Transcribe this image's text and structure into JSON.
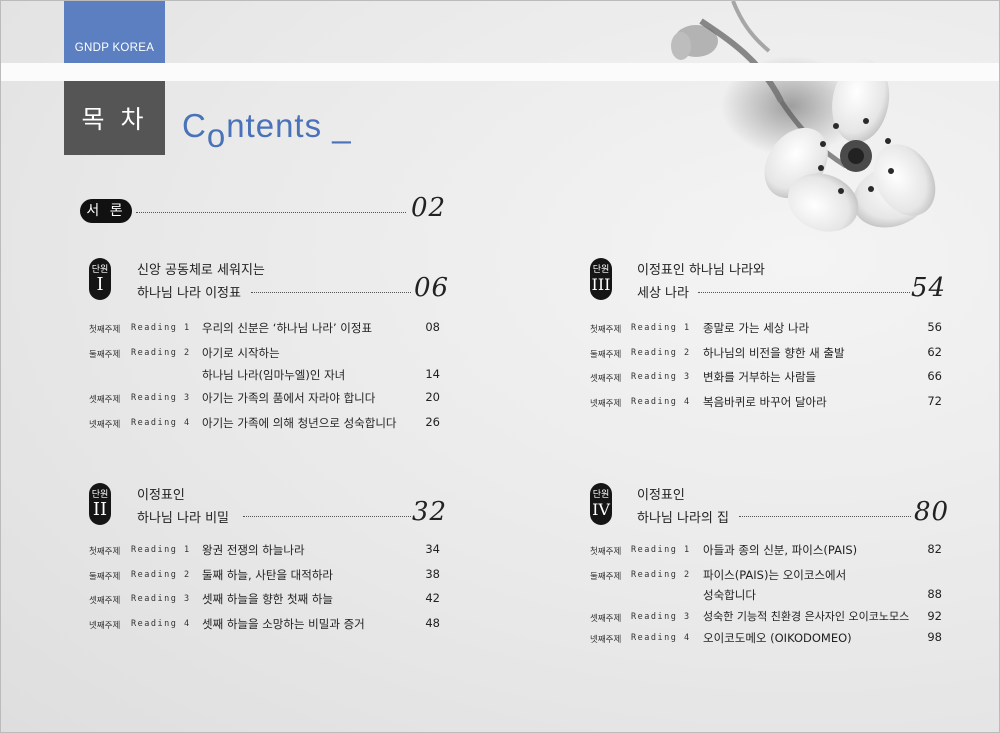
{
  "header": {
    "brand": "GNDP KOREA",
    "toc_label": "목 차",
    "title_c": "C",
    "title_o": "o",
    "title_rest": "ntents _"
  },
  "intro": {
    "label": "서 론",
    "page": "02"
  },
  "units": [
    {
      "badge": "단원",
      "numeral": "I",
      "title_line1": "신앙 공동체로 세워지는",
      "title_line2": "하나님 나라 이정표",
      "page": "06",
      "rows": [
        {
          "week": "첫째주제",
          "reading": "Reading 1",
          "title": "우리의 신분은 ‘하나님 나라’ 이정표",
          "page": "08"
        },
        {
          "week": "둘째주제",
          "reading": "Reading 2",
          "title": "아기로 시작하는",
          "page": ""
        },
        {
          "week": "",
          "reading": "",
          "title": "하나님 나라(임마누엘)인 자녀",
          "page": "14"
        },
        {
          "week": "셋째주제",
          "reading": "Reading 3",
          "title": "아기는 가족의 품에서 자라야 합니다",
          "page": "20"
        },
        {
          "week": "넷째주제",
          "reading": "Reading 4",
          "title": "아기는 가족에 의해 청년으로 성숙합니다",
          "page": "26"
        }
      ]
    },
    {
      "badge": "단원",
      "numeral": "II",
      "title_line1": "이정표인",
      "title_line2": "하나님 나라 비밀",
      "page": "32",
      "rows": [
        {
          "week": "첫째주제",
          "reading": "Reading 1",
          "title": "왕권 전쟁의 하늘나라",
          "page": "34"
        },
        {
          "week": "둘째주제",
          "reading": "Reading 2",
          "title": "둘째 하늘, 사탄을 대적하라",
          "page": "38"
        },
        {
          "week": "셋째주제",
          "reading": "Reading 3",
          "title": "셋째 하늘을 향한 첫째 하늘",
          "page": "42"
        },
        {
          "week": "넷째주제",
          "reading": "Reading 4",
          "title": "셋째 하늘을 소망하는 비밀과 증거",
          "page": "48"
        }
      ]
    },
    {
      "badge": "단원",
      "numeral": "III",
      "title_line1": "이정표인 하나님 나라와",
      "title_line2": "세상 나라",
      "page": "54",
      "rows": [
        {
          "week": "첫째주제",
          "reading": "Reading 1",
          "title": "종말로 가는 세상 나라",
          "page": "56"
        },
        {
          "week": "둘째주제",
          "reading": "Reading 2",
          "title": "하나님의 비전을 향한 새 출발",
          "page": "62"
        },
        {
          "week": "셋째주제",
          "reading": "Reading 3",
          "title": "변화를 거부하는 사람들",
          "page": "66"
        },
        {
          "week": "넷째주제",
          "reading": "Reading 4",
          "title": "복음바퀴로 바꾸어 달아라",
          "page": "72"
        }
      ]
    },
    {
      "badge": "단원",
      "numeral": "IV",
      "title_line1": "이정표인",
      "title_line2": "하나님 나라의 집",
      "page": "80",
      "rows": [
        {
          "week": "첫째주제",
          "reading": "Reading 1",
          "title": "아들과 종의 신분, 파이스(PAIS)",
          "page": "82"
        },
        {
          "week": "둘째주제",
          "reading": "Reading 2",
          "title": "파이스(PAIS)는 오이코스에서",
          "page": ""
        },
        {
          "week": "",
          "reading": "",
          "title": "성숙합니다",
          "page": "88"
        },
        {
          "week": "셋째주제",
          "reading": "Reading 3",
          "title": "성숙한 기능적 친환경 은사자인 오이코노모스",
          "page": "92"
        },
        {
          "week": "넷째주제",
          "reading": "Reading 4",
          "title": "오이코도메오 (OIKODOMEO)",
          "page": "98"
        }
      ]
    }
  ]
}
